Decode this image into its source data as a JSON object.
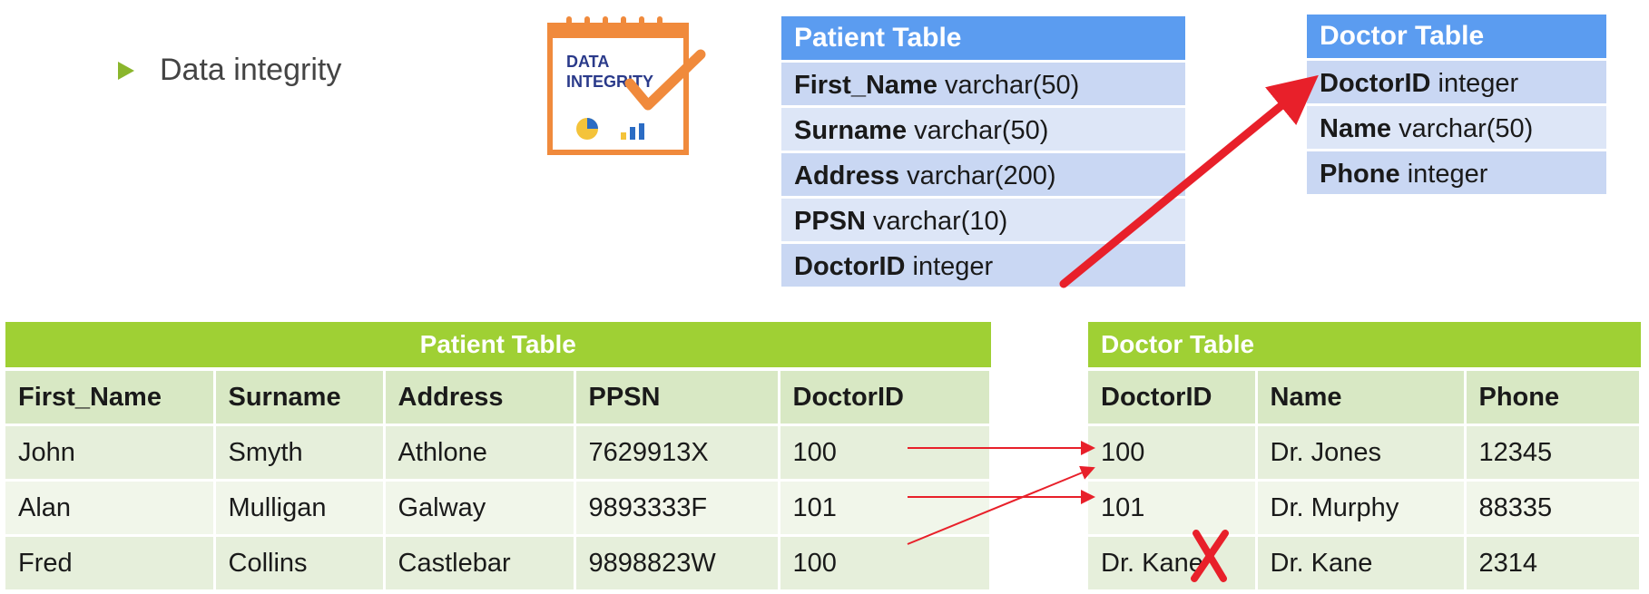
{
  "bullet": {
    "text": "Data integrity"
  },
  "logo": {
    "line1": "DATA",
    "line2": "INTEGRITY"
  },
  "patient_schema": {
    "title": "Patient Table",
    "fields": [
      {
        "name": "First_Name",
        "type": "varchar(50)"
      },
      {
        "name": "Surname",
        "type": "varchar(50)"
      },
      {
        "name": "Address",
        "type": "varchar(200)"
      },
      {
        "name": "PPSN",
        "type": "varchar(10)"
      },
      {
        "name": "DoctorID",
        "type": "integer"
      }
    ]
  },
  "doctor_schema": {
    "title": "Doctor Table",
    "fields": [
      {
        "name": "DoctorID",
        "type": "integer"
      },
      {
        "name": "Name",
        "type": "varchar(50)"
      },
      {
        "name": "Phone",
        "type": "integer"
      }
    ]
  },
  "patient_data": {
    "title": "Patient Table",
    "columns": [
      "First_Name",
      "Surname",
      "Address",
      "PPSN",
      "DoctorID"
    ],
    "rows": [
      [
        "John",
        "Smyth",
        "Athlone",
        "7629913X",
        "100"
      ],
      [
        "Alan",
        "Mulligan",
        "Galway",
        "9893333F",
        "101"
      ],
      [
        "Fred",
        "Collins",
        "Castlebar",
        "9898823W",
        "100"
      ]
    ]
  },
  "doctor_data": {
    "title": "Doctor Table",
    "columns": [
      "DoctorID",
      "Name",
      "Phone"
    ],
    "rows": [
      [
        "100",
        "Dr. Jones",
        "12345"
      ],
      [
        "101",
        "Dr. Murphy",
        "88335"
      ],
      [
        "Dr. Kane",
        "Dr. Kane",
        "2314"
      ]
    ]
  },
  "colors": {
    "bullet": "#8ab62c",
    "schema_header": "#5b9cf0",
    "data_header": "#9fd034",
    "arrow": "#e8202a",
    "logo_orange": "#f08a3c"
  }
}
